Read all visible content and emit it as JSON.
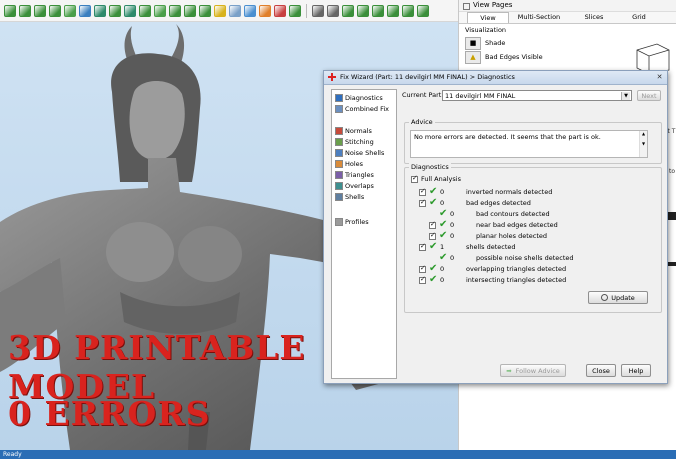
{
  "status_bar": {
    "text": "Ready"
  },
  "overlay": {
    "line1": "3D PRINTABLE MODEL",
    "line2": "0 ERRORS"
  },
  "right_panel": {
    "title": "View Pages",
    "tabs": [
      "View",
      "Multi-Section",
      "Slices",
      "Grid"
    ],
    "section": "Visualization",
    "rows": [
      {
        "label": "Shade"
      },
      {
        "label": "Bad Edges Visible"
      }
    ],
    "fragments": [
      "rt T",
      "to"
    ]
  },
  "dialog": {
    "title": "Fix Wizard (Part: 11 devilgirl MM FINAL) > Diagnostics",
    "nav_items": [
      {
        "label": "Diagnostics",
        "color": "#2f6fbf"
      },
      {
        "label": "Combined Fix",
        "color": "#6b8fbf"
      },
      {
        "label": "Normals",
        "color": "#c74b3b"
      },
      {
        "label": "Stitching",
        "color": "#6a9f4c"
      },
      {
        "label": "Noise Shells",
        "color": "#4d7fbf"
      },
      {
        "label": "Holes",
        "color": "#d98b3a"
      },
      {
        "label": "Triangles",
        "color": "#7b5fa8"
      },
      {
        "label": "Overlaps",
        "color": "#3e8f8f"
      },
      {
        "label": "Shells",
        "color": "#5f7fa0"
      },
      {
        "label": "Profiles",
        "color": "#9a9a9a"
      }
    ],
    "current_part_label": "Current Part:",
    "current_part_value": "11 devilgirl MM FINAL",
    "next_label": "Next",
    "advice_label": "Advice",
    "advice_text": "No more errors are detected. It seems that the part is ok.",
    "diagnostics_label": "Diagnostics",
    "full_analysis_label": "Full Analysis",
    "diagnostics": [
      {
        "label": "inverted normals detected",
        "count": "0",
        "level": 0,
        "checkbox": true
      },
      {
        "label": "bad edges detected",
        "count": "0",
        "level": 0,
        "checkbox": true
      },
      {
        "label": "bad contours detected",
        "count": "0",
        "level": 1,
        "checkbox": false
      },
      {
        "label": "near bad edges detected",
        "count": "0",
        "level": 1,
        "checkbox": true
      },
      {
        "label": "planar holes detected",
        "count": "0",
        "level": 1,
        "checkbox": true
      },
      {
        "label": "shells detected",
        "count": "1",
        "level": 0,
        "checkbox": true
      },
      {
        "label": "possible noise shells detected",
        "count": "0",
        "level": 1,
        "checkbox": false
      },
      {
        "label": "overlapping triangles detected",
        "count": "0",
        "level": 0,
        "checkbox": true
      },
      {
        "label": "intersecting triangles detected",
        "count": "0",
        "level": 0,
        "checkbox": true
      }
    ],
    "update_label": "Update",
    "follow_advice_label": "Follow Advice",
    "close_label": "Close",
    "help_label": "Help"
  }
}
